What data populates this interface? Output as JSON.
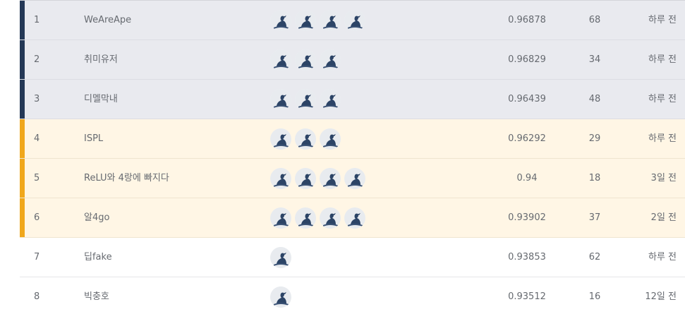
{
  "leaderboard": {
    "rows": [
      {
        "rank": "1",
        "team": "WeAreApe",
        "members": 4,
        "score": "0.96878",
        "entries": "68",
        "last": "하루 전",
        "tier": "silver"
      },
      {
        "rank": "2",
        "team": "취미유저",
        "members": 3,
        "score": "0.96829",
        "entries": "34",
        "last": "하루 전",
        "tier": "silver"
      },
      {
        "rank": "3",
        "team": "디멜막내",
        "members": 3,
        "score": "0.96439",
        "entries": "48",
        "last": "하루 전",
        "tier": "silver"
      },
      {
        "rank": "4",
        "team": "ISPL",
        "members": 3,
        "score": "0.96292",
        "entries": "29",
        "last": "하루 전",
        "tier": "gold"
      },
      {
        "rank": "5",
        "team": "ReLU와 4랑에 빠지다",
        "members": 4,
        "score": "0.94",
        "entries": "18",
        "last": "3일 전",
        "tier": "gold"
      },
      {
        "rank": "6",
        "team": "알4go",
        "members": 4,
        "score": "0.93902",
        "entries": "37",
        "last": "2일 전",
        "tier": "gold"
      },
      {
        "rank": "7",
        "team": "딥fake",
        "members": 1,
        "score": "0.93853",
        "entries": "62",
        "last": "하루 전",
        "tier": "plain"
      },
      {
        "rank": "8",
        "team": "빅충호",
        "members": 1,
        "score": "0.93512",
        "entries": "16",
        "last": "12일 전",
        "tier": "plain"
      }
    ],
    "avatar_icon": "user-avatar-icon",
    "colors": {
      "silver_stripe": "#243856",
      "gold_stripe": "#f0a71c",
      "silver_bg": "#e9eaef",
      "gold_bg": "#fff6e5"
    }
  }
}
